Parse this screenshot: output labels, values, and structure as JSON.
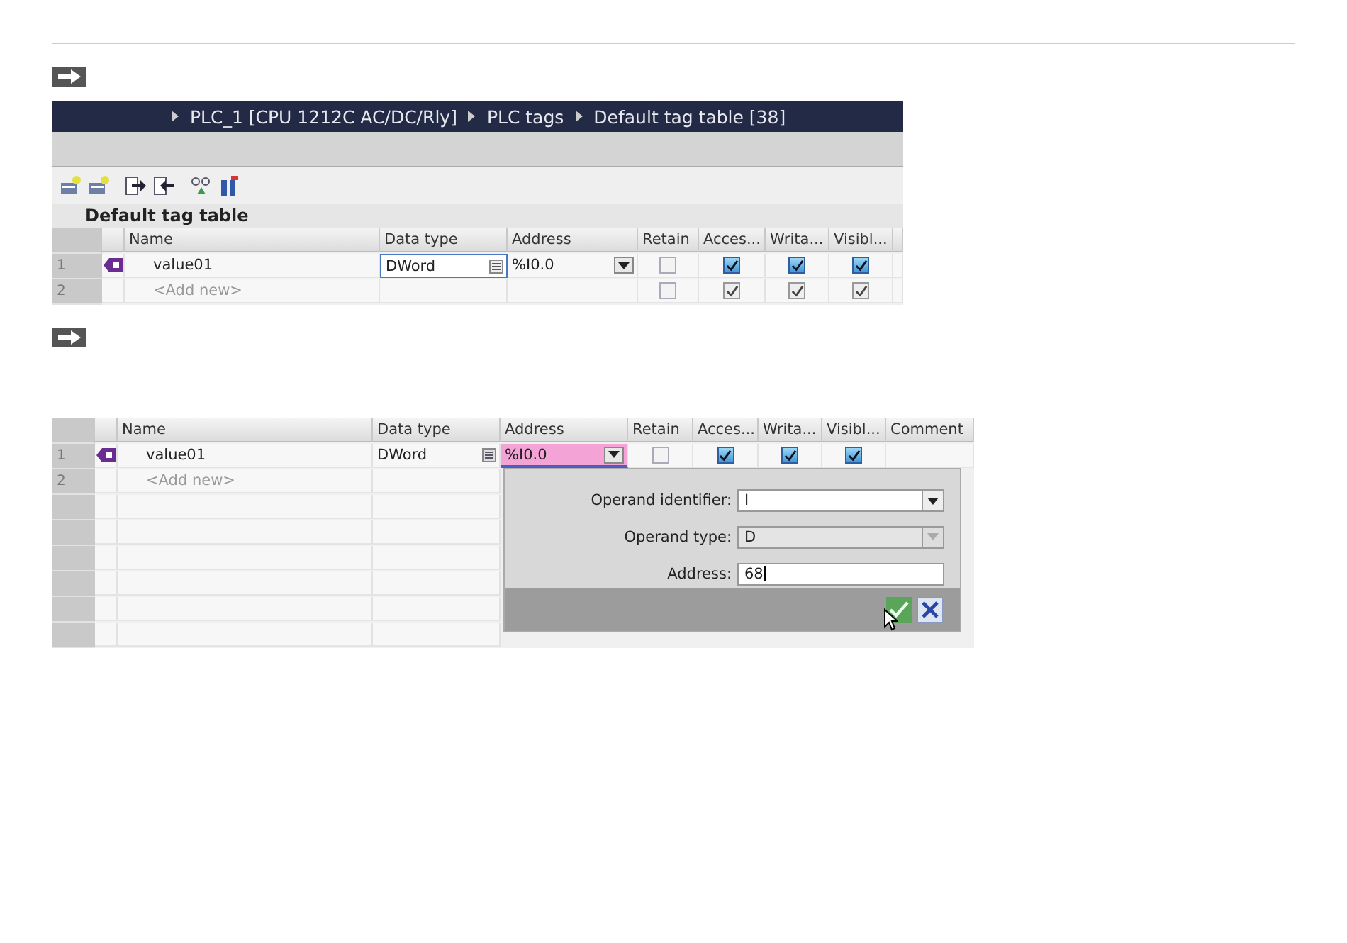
{
  "step_1": {
    "breadcrumb": [
      "PLC_1 [CPU 1212C AC/DC/Rly]",
      "PLC tags",
      "Default tag table [38]"
    ],
    "table_title": "Default tag table",
    "columns": [
      "Name",
      "Data type",
      "Address",
      "Retain",
      "Acces...",
      "Writa...",
      "Visibl..."
    ],
    "rows": [
      {
        "number": "1",
        "kind": "tag",
        "name": "value01",
        "data_type": "DWord",
        "data_type_editing": true,
        "address": "%I0.0",
        "address_editing": false,
        "retain": false,
        "accessible": true,
        "writable": true,
        "visible": true
      },
      {
        "number": "2",
        "kind": "add-new",
        "name": "<Add new>",
        "retain": false,
        "accessible": true,
        "writable": true,
        "visible": true
      }
    ]
  },
  "step_2": {
    "columns": [
      "Name",
      "Data type",
      "Address",
      "Retain",
      "Acces...",
      "Writa...",
      "Visibl...",
      "Comment"
    ],
    "rows": [
      {
        "number": "1",
        "kind": "tag",
        "name": "value01",
        "data_type": "DWord",
        "data_type_editing": false,
        "address": "%I0.0",
        "address_editing": true,
        "retain": false,
        "accessible": true,
        "writable": true,
        "visible": true
      },
      {
        "number": "2",
        "kind": "add-new",
        "name": "<Add new>"
      }
    ],
    "popup": {
      "fields": [
        {
          "kind": "dropdown",
          "label": "Operand identifier:",
          "value": "I",
          "disabled": false
        },
        {
          "kind": "dropdown",
          "label": "Operand type:",
          "value": "D",
          "disabled": true
        },
        {
          "kind": "text",
          "label": "Address:",
          "value": "68",
          "disabled": false
        }
      ]
    }
  }
}
